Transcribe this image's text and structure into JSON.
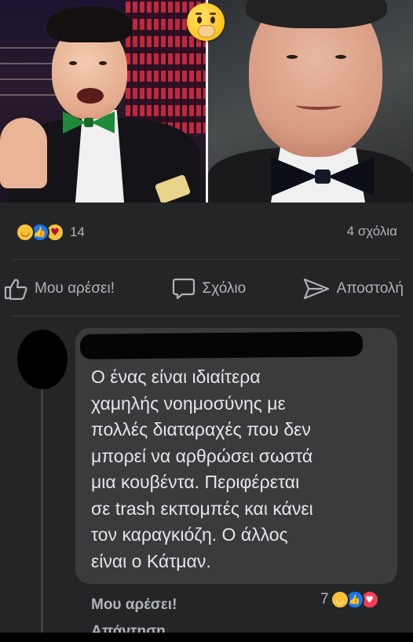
{
  "post": {
    "reactions": {
      "icons": [
        "haha-icon",
        "like-icon",
        "care-icon"
      ],
      "count": "14"
    },
    "comment_count": "4 σχόλια"
  },
  "actions": {
    "like_label": "Μου αρέσει!",
    "comment_label": "Σχόλιο",
    "share_label": "Αποστολή"
  },
  "comment": {
    "text": "Ο ένας είναι ιδιαίτερα\nχαμηλής νοημοσύνης με\nπολλές διαταραχές που δεν\nμπορεί να αρθρώσει σωστά\nμια κουβέντα. Περιφέρεται\nσε trash εκπομπές και κάνει\nτον καραγκιόζη. Ο άλλος\nείναι ο Κάτμαν.",
    "like_label": "Μου αρέσει!",
    "reply_label": "Απάντηση",
    "reaction_count": "7",
    "reaction_icons": [
      "haha-icon",
      "like-icon",
      "love-icon"
    ]
  },
  "watermark": "132910",
  "colors": {
    "background": "#242526",
    "bubble": "#3a3b3c",
    "text": "#e4e6eb",
    "muted": "#b0b3b8",
    "like_blue": "#1877f2"
  }
}
